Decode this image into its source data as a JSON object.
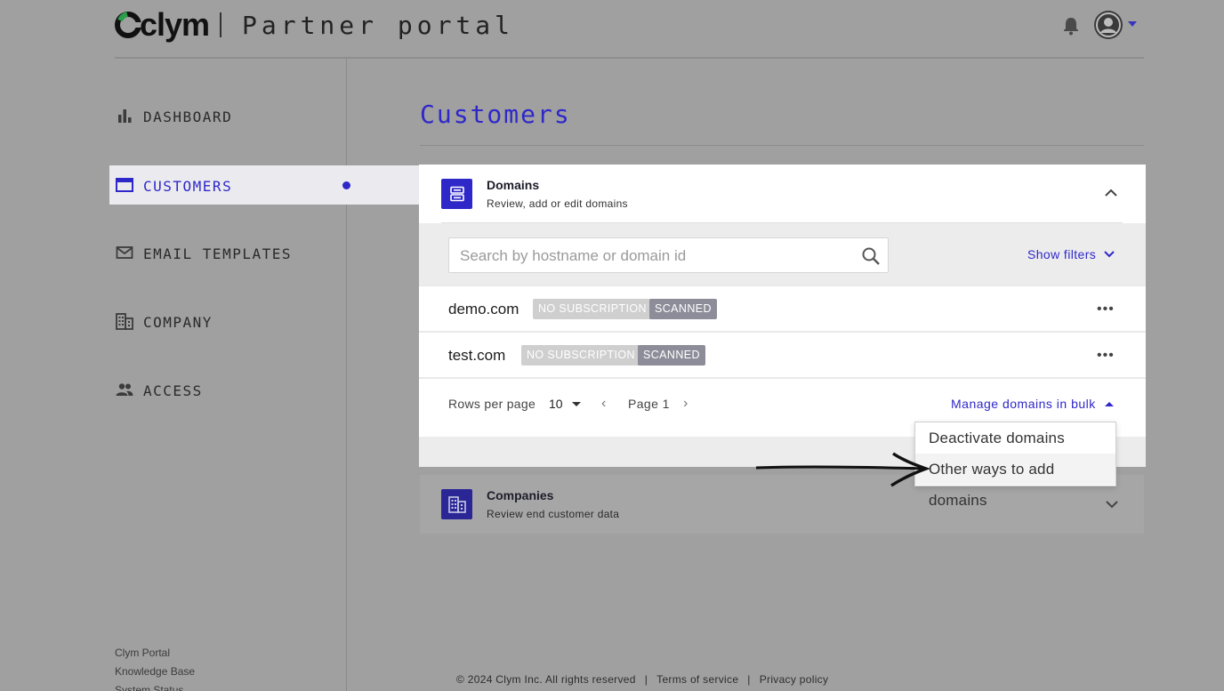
{
  "header": {
    "logo_text": "clym",
    "portal_title": "Partner portal"
  },
  "sidebar": {
    "items": [
      {
        "label": "DASHBOARD",
        "icon": "bar-chart-icon"
      },
      {
        "label": "CUSTOMERS",
        "icon": "folder-window-icon",
        "active": true
      },
      {
        "label": "EMAIL TEMPLATES",
        "icon": "mail-icon"
      },
      {
        "label": "COMPANY",
        "icon": "building-icon"
      },
      {
        "label": "ACCESS",
        "icon": "people-icon"
      }
    ],
    "footer_links": [
      "Clym Portal",
      "Knowledge Base",
      "System Status"
    ]
  },
  "main": {
    "page_title": "Customers",
    "domains_card": {
      "title": "Domains",
      "subtitle": "Review, add or edit domains",
      "search_placeholder": "Search by hostname or domain id",
      "show_filters": "Show filters",
      "rows": [
        {
          "name": "demo.com",
          "badges": [
            "NO SUBSCRIPTION",
            "SCANNED"
          ]
        },
        {
          "name": "test.com",
          "badges": [
            "NO SUBSCRIPTION",
            "SCANNED"
          ]
        }
      ],
      "rows_per_page_label": "Rows per page",
      "rows_per_page_value": "10",
      "page_label": "Page 1",
      "manage_bulk": "Manage domains in bulk",
      "bulk_menu": [
        "Deactivate domains",
        "Other ways to add domains"
      ]
    },
    "companies_card": {
      "title": "Companies",
      "subtitle": "Review end customer data"
    }
  },
  "footer": {
    "copyright": "© 2024 Clym Inc. All rights reserved",
    "sep": "|",
    "terms": "Terms of service",
    "privacy": "Privacy policy"
  },
  "colors": {
    "accent": "#2f28c9",
    "badge_nosub": "#cfcfcf",
    "badge_scanned": "#8d8d9a"
  }
}
